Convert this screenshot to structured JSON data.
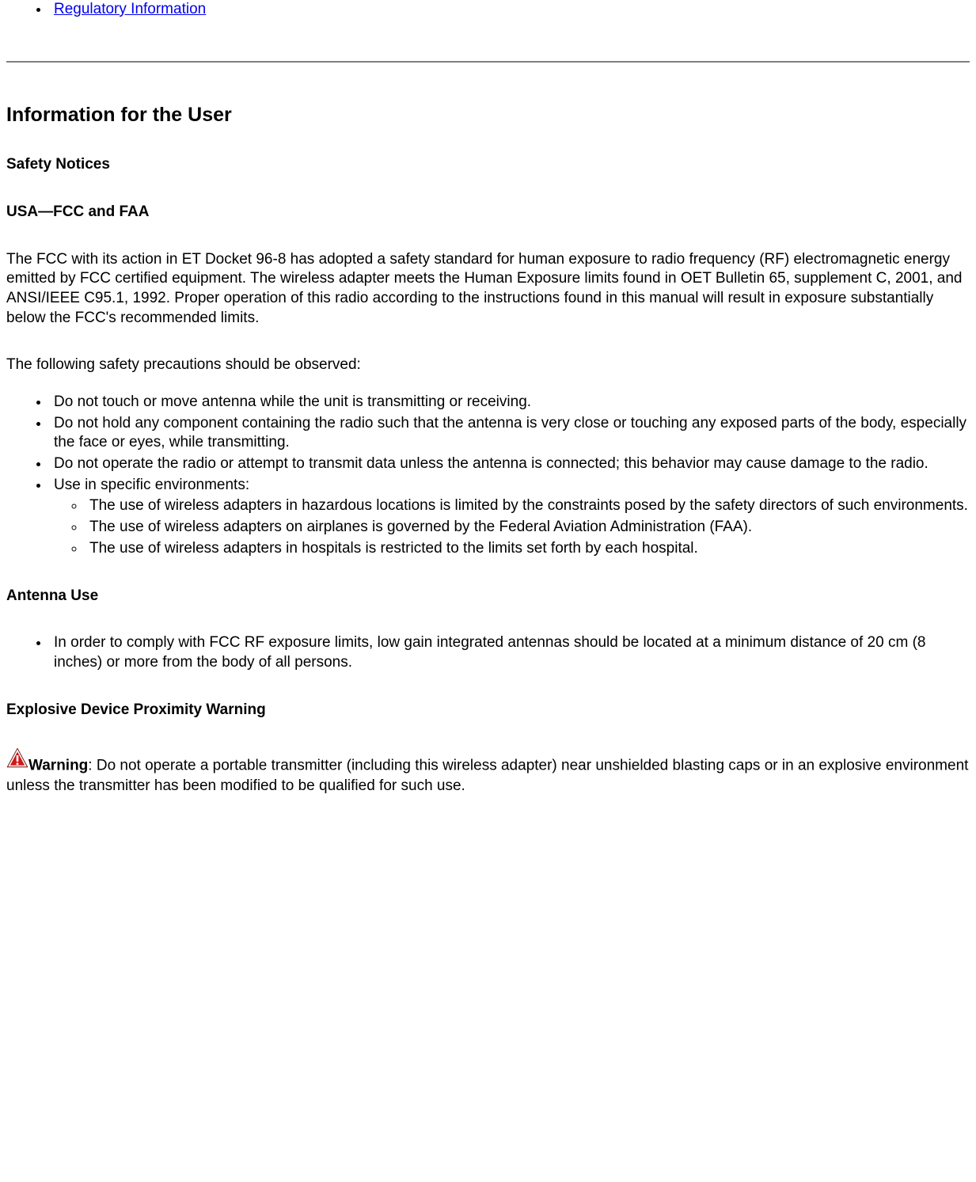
{
  "topLink": {
    "label": "Regulatory Information"
  },
  "section": {
    "title": "Information for the User"
  },
  "safety": {
    "title": "Safety Notices",
    "usa": {
      "title": "USA—FCC and FAA",
      "para1": "The FCC with its action in ET Docket 96-8 has adopted a safety standard for human exposure to radio frequency (RF) electromagnetic energy emitted by FCC certified equipment. The wireless adapter meets the Human Exposure limits found in OET Bulletin 65, supplement C, 2001, and ANSI/IEEE C95.1, 1992. Proper operation of this radio according to the instructions found in this manual will result in exposure substantially below the FCC's recommended limits.",
      "para2": "The following safety precautions should be observed:",
      "bullets": [
        "Do not touch or move antenna while the unit is transmitting or receiving.",
        "Do not hold any component containing the radio such that the antenna is very close or touching any exposed parts of the body, especially the face or eyes, while transmitting.",
        "Do not operate the radio or attempt to transmit data unless the antenna is connected; this behavior may cause damage to the radio.",
        "Use in specific environments:"
      ],
      "subBullets": [
        "The use of wireless adapters in hazardous locations is limited by the constraints posed by the safety directors of such environments.",
        "The use of wireless adapters on airplanes is governed by the Federal Aviation Administration (FAA).",
        "The use of wireless adapters in hospitals is restricted to the limits set forth by each hospital."
      ]
    },
    "antenna": {
      "title": "Antenna Use",
      "bullets": [
        "In order to comply with FCC RF exposure limits, low gain integrated antennas should be located at a minimum distance of 20 cm (8 inches) or more from the body of all persons."
      ]
    },
    "explosive": {
      "title": "Explosive Device Proximity Warning",
      "warningLabel": "Warning",
      "warningText": ": Do not operate a portable transmitter (including this wireless adapter) near unshielded blasting caps or in an explosive environment unless the transmitter has been modified to be qualified for such use."
    }
  }
}
